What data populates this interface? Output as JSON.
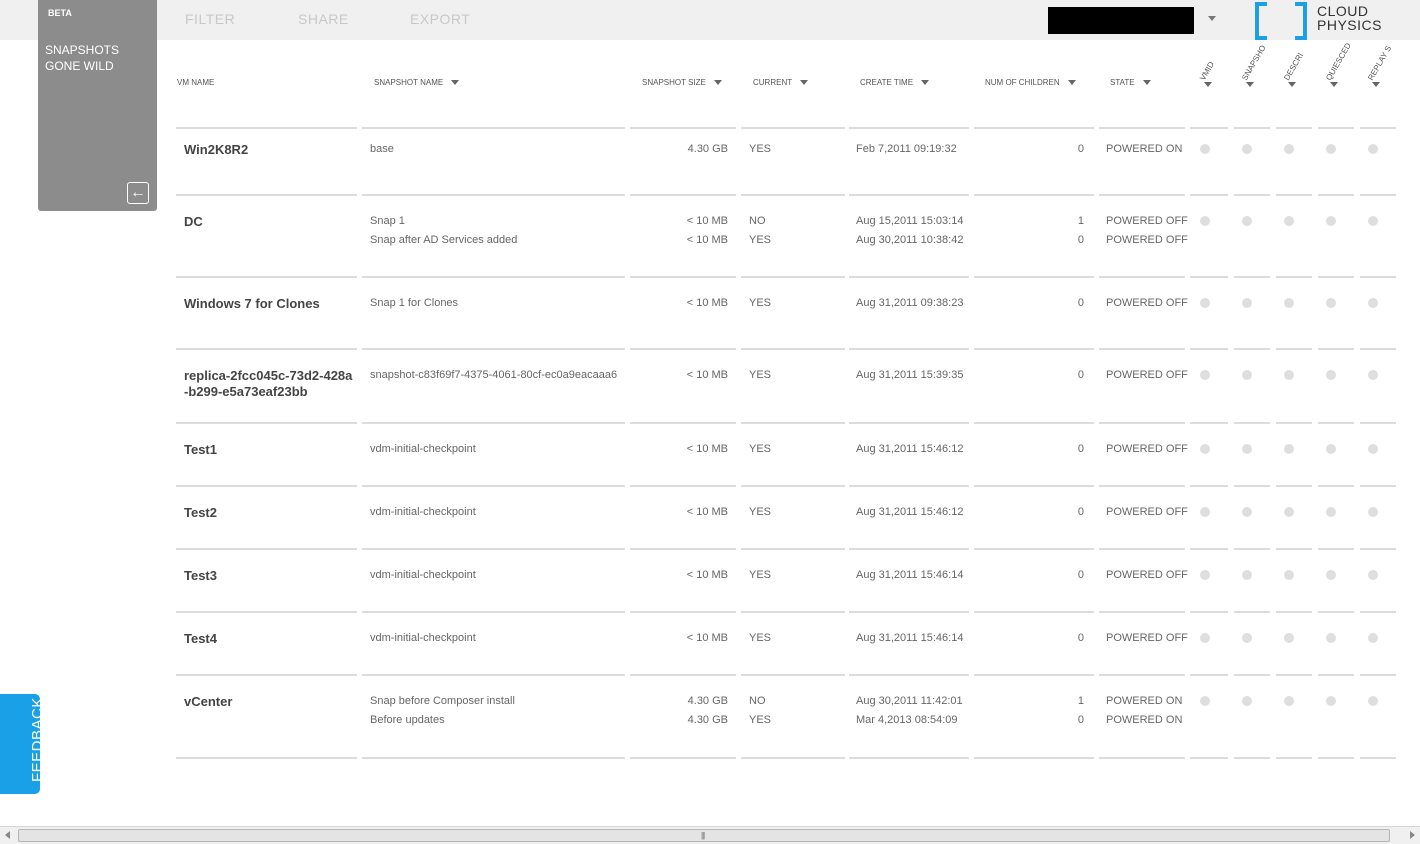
{
  "toolbar": {
    "filter": "FILTER",
    "share": "SHARE",
    "export": "EXPORT"
  },
  "logo": {
    "line1": "CLOUD",
    "line2": "PHYSICS"
  },
  "sidebar": {
    "beta": "BETA",
    "title": "SNAPSHOTS GONE WILD",
    "back_icon": "arrow-left-icon"
  },
  "columns": {
    "vm_name": "VM NAME",
    "snapshot_name": "SNAPSHOT NAME",
    "snapshot_size": "SNAPSHOT SIZE",
    "current": "CURRENT",
    "create_time": "CREATE TIME",
    "num_children": "NUM OF CHILDREN",
    "state": "STATE",
    "rotated": [
      "VMID",
      "SNAPSHO",
      "DESCRI",
      "QUIESCED",
      "REPLAY S"
    ]
  },
  "rows": [
    {
      "vm": "Win2K8R2",
      "snaps": [
        {
          "name": "base",
          "size": "4.30 GB",
          "current": "YES",
          "time": "Feb 7,2011 09:19:32",
          "children": "0",
          "state": "POWERED ON"
        }
      ]
    },
    {
      "vm": "DC",
      "snaps": [
        {
          "name": "Snap 1",
          "size": "< 10 MB",
          "current": "NO",
          "time": "Aug 15,2011 15:03:14",
          "children": "1",
          "state": "POWERED OFF"
        },
        {
          "name": "Snap after AD Services added",
          "size": "< 10 MB",
          "current": "YES",
          "time": "Aug 30,2011 10:38:42",
          "children": "0",
          "state": "POWERED OFF"
        }
      ]
    },
    {
      "vm": "Windows 7 for Clones",
      "snaps": [
        {
          "name": "Snap 1 for Clones",
          "size": "< 10 MB",
          "current": "YES",
          "time": "Aug 31,2011 09:38:23",
          "children": "0",
          "state": "POWERED OFF"
        }
      ]
    },
    {
      "vm": "replica-2fcc045c-73d2-428a-b299-e5a73eaf23bb",
      "snaps": [
        {
          "name": "snapshot-c83f69f7-4375-4061-80cf-ec0a9eacaaa6",
          "size": "< 10 MB",
          "current": "YES",
          "time": "Aug 31,2011 15:39:35",
          "children": "0",
          "state": "POWERED OFF"
        }
      ]
    },
    {
      "vm": "Test1",
      "snaps": [
        {
          "name": "vdm-initial-checkpoint",
          "size": "< 10 MB",
          "current": "YES",
          "time": "Aug 31,2011 15:46:12",
          "children": "0",
          "state": "POWERED OFF"
        }
      ]
    },
    {
      "vm": "Test2",
      "snaps": [
        {
          "name": "vdm-initial-checkpoint",
          "size": "< 10 MB",
          "current": "YES",
          "time": "Aug 31,2011 15:46:12",
          "children": "0",
          "state": "POWERED OFF"
        }
      ]
    },
    {
      "vm": "Test3",
      "snaps": [
        {
          "name": "vdm-initial-checkpoint",
          "size": "< 10 MB",
          "current": "YES",
          "time": "Aug 31,2011 15:46:14",
          "children": "0",
          "state": "POWERED OFF"
        }
      ]
    },
    {
      "vm": "Test4",
      "snaps": [
        {
          "name": "vdm-initial-checkpoint",
          "size": "< 10 MB",
          "current": "YES",
          "time": "Aug 31,2011 15:46:14",
          "children": "0",
          "state": "POWERED OFF"
        }
      ]
    },
    {
      "vm": "vCenter",
      "snaps": [
        {
          "name": "Snap before Composer install",
          "size": "4.30 GB",
          "current": "NO",
          "time": "Aug 30,2011 11:42:01",
          "children": "1",
          "state": "POWERED ON"
        },
        {
          "name": "Before updates",
          "size": "4.30 GB",
          "current": "YES",
          "time": "Mar 4,2013 08:54:09",
          "children": "0",
          "state": "POWERED ON"
        }
      ]
    }
  ],
  "feedback": "FEEDBACK",
  "colors": {
    "accent": "#1aa0e6",
    "panel": "#8c8c8c"
  }
}
